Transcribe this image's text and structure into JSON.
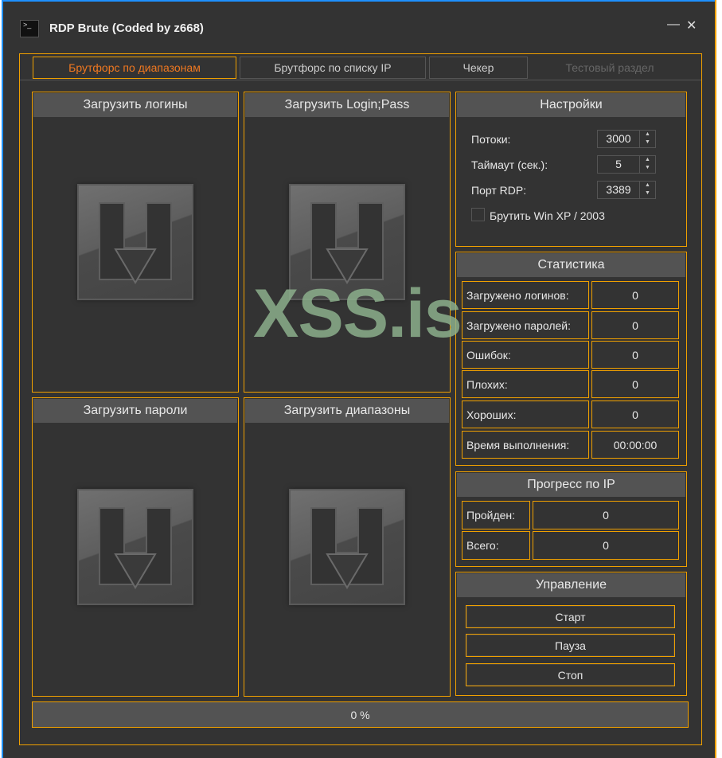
{
  "window": {
    "title": "RDP Brute (Coded by z668)",
    "minimize": "—",
    "close": "✕",
    "icon_text": ">_"
  },
  "tabs": [
    {
      "label": "Брутфорс по диапазонам",
      "state": "active"
    },
    {
      "label": "Брутфорс по списку IP",
      "state": "normal"
    },
    {
      "label": "Чекер",
      "state": "normal"
    },
    {
      "label": "Тестовый раздел",
      "state": "disabled"
    }
  ],
  "loaders": [
    {
      "label": "Загрузить логины"
    },
    {
      "label": "Загрузить Login;Pass"
    },
    {
      "label": "Загрузить пароли"
    },
    {
      "label": "Загрузить диапазоны"
    }
  ],
  "settings": {
    "title": "Настройки",
    "threads_label": "Потоки:",
    "threads": "3000",
    "timeout_label": "Таймаут (сек.):",
    "timeout": "5",
    "port_label": "Порт RDP:",
    "port": "3389",
    "winxp_label": "Брутить Win XP / 2003",
    "winxp_checked": false
  },
  "stats": {
    "title": "Статистика",
    "rows": [
      {
        "label": "Загружено логинов:",
        "value": "0"
      },
      {
        "label": "Загружено паролей:",
        "value": "0"
      },
      {
        "label": "Ошибок:",
        "value": "0"
      },
      {
        "label": "Плохих:",
        "value": "0"
      },
      {
        "label": "Хороших:",
        "value": "0"
      },
      {
        "label": "Время выполнения:",
        "value": "00:00:00"
      }
    ]
  },
  "ip_progress": {
    "title": "Прогресс по IP",
    "rows": [
      {
        "label": "Пройден:",
        "value": "0"
      },
      {
        "label": "Всего:",
        "value": "0"
      }
    ]
  },
  "control": {
    "title": "Управление",
    "start": "Старт",
    "pause": "Пауза",
    "stop": "Стоп"
  },
  "progress": {
    "text": "0 %",
    "percent": 0
  },
  "watermark": "XSS.is",
  "colors": {
    "accent": "#f0a000",
    "active_tab_text": "#f07820",
    "background": "#333333",
    "header": "#535353"
  }
}
